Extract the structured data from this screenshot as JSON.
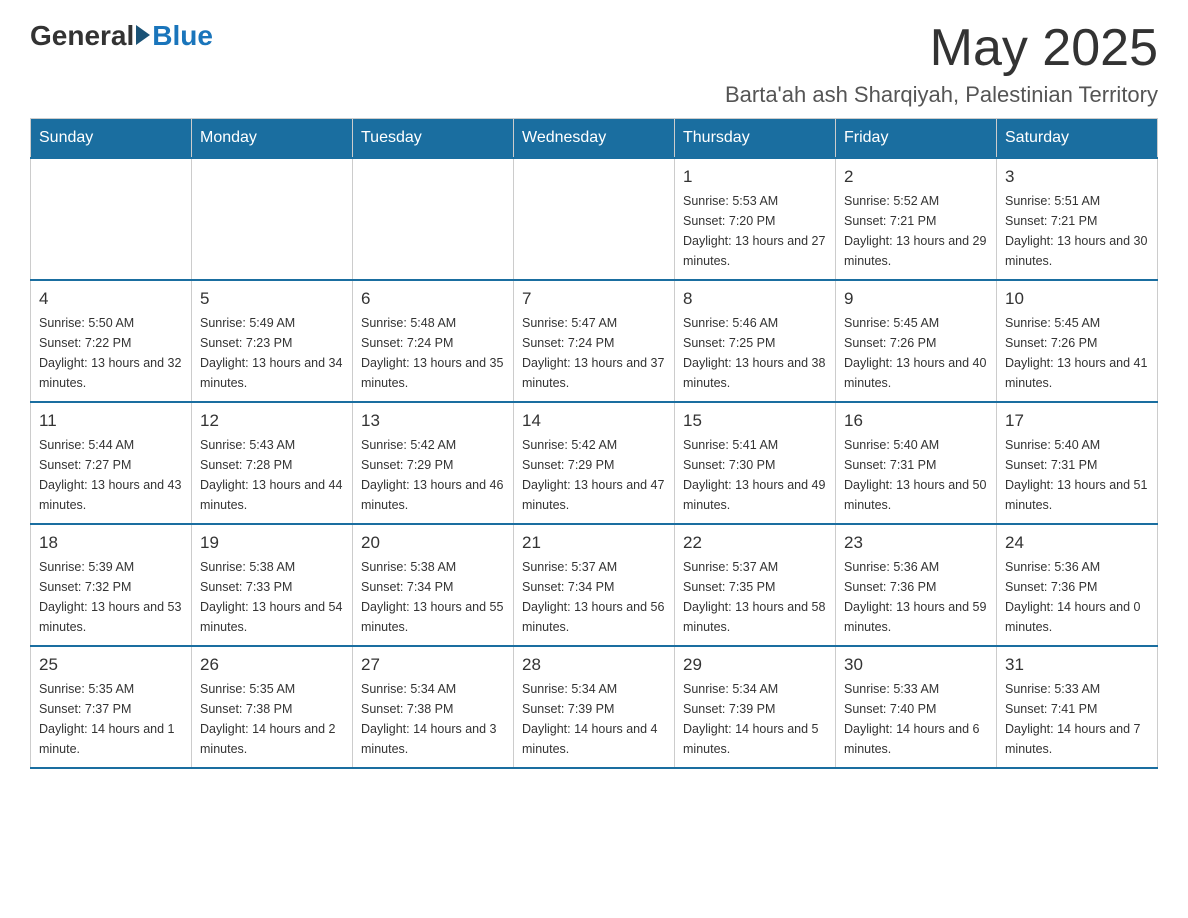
{
  "logo": {
    "general": "General",
    "blue": "Blue"
  },
  "title": {
    "month_year": "May 2025",
    "location": "Barta'ah ash Sharqiyah, Palestinian Territory"
  },
  "days_of_week": [
    "Sunday",
    "Monday",
    "Tuesday",
    "Wednesday",
    "Thursday",
    "Friday",
    "Saturday"
  ],
  "weeks": [
    [
      {
        "day": "",
        "info": ""
      },
      {
        "day": "",
        "info": ""
      },
      {
        "day": "",
        "info": ""
      },
      {
        "day": "",
        "info": ""
      },
      {
        "day": "1",
        "info": "Sunrise: 5:53 AM\nSunset: 7:20 PM\nDaylight: 13 hours and 27 minutes."
      },
      {
        "day": "2",
        "info": "Sunrise: 5:52 AM\nSunset: 7:21 PM\nDaylight: 13 hours and 29 minutes."
      },
      {
        "day": "3",
        "info": "Sunrise: 5:51 AM\nSunset: 7:21 PM\nDaylight: 13 hours and 30 minutes."
      }
    ],
    [
      {
        "day": "4",
        "info": "Sunrise: 5:50 AM\nSunset: 7:22 PM\nDaylight: 13 hours and 32 minutes."
      },
      {
        "day": "5",
        "info": "Sunrise: 5:49 AM\nSunset: 7:23 PM\nDaylight: 13 hours and 34 minutes."
      },
      {
        "day": "6",
        "info": "Sunrise: 5:48 AM\nSunset: 7:24 PM\nDaylight: 13 hours and 35 minutes."
      },
      {
        "day": "7",
        "info": "Sunrise: 5:47 AM\nSunset: 7:24 PM\nDaylight: 13 hours and 37 minutes."
      },
      {
        "day": "8",
        "info": "Sunrise: 5:46 AM\nSunset: 7:25 PM\nDaylight: 13 hours and 38 minutes."
      },
      {
        "day": "9",
        "info": "Sunrise: 5:45 AM\nSunset: 7:26 PM\nDaylight: 13 hours and 40 minutes."
      },
      {
        "day": "10",
        "info": "Sunrise: 5:45 AM\nSunset: 7:26 PM\nDaylight: 13 hours and 41 minutes."
      }
    ],
    [
      {
        "day": "11",
        "info": "Sunrise: 5:44 AM\nSunset: 7:27 PM\nDaylight: 13 hours and 43 minutes."
      },
      {
        "day": "12",
        "info": "Sunrise: 5:43 AM\nSunset: 7:28 PM\nDaylight: 13 hours and 44 minutes."
      },
      {
        "day": "13",
        "info": "Sunrise: 5:42 AM\nSunset: 7:29 PM\nDaylight: 13 hours and 46 minutes."
      },
      {
        "day": "14",
        "info": "Sunrise: 5:42 AM\nSunset: 7:29 PM\nDaylight: 13 hours and 47 minutes."
      },
      {
        "day": "15",
        "info": "Sunrise: 5:41 AM\nSunset: 7:30 PM\nDaylight: 13 hours and 49 minutes."
      },
      {
        "day": "16",
        "info": "Sunrise: 5:40 AM\nSunset: 7:31 PM\nDaylight: 13 hours and 50 minutes."
      },
      {
        "day": "17",
        "info": "Sunrise: 5:40 AM\nSunset: 7:31 PM\nDaylight: 13 hours and 51 minutes."
      }
    ],
    [
      {
        "day": "18",
        "info": "Sunrise: 5:39 AM\nSunset: 7:32 PM\nDaylight: 13 hours and 53 minutes."
      },
      {
        "day": "19",
        "info": "Sunrise: 5:38 AM\nSunset: 7:33 PM\nDaylight: 13 hours and 54 minutes."
      },
      {
        "day": "20",
        "info": "Sunrise: 5:38 AM\nSunset: 7:34 PM\nDaylight: 13 hours and 55 minutes."
      },
      {
        "day": "21",
        "info": "Sunrise: 5:37 AM\nSunset: 7:34 PM\nDaylight: 13 hours and 56 minutes."
      },
      {
        "day": "22",
        "info": "Sunrise: 5:37 AM\nSunset: 7:35 PM\nDaylight: 13 hours and 58 minutes."
      },
      {
        "day": "23",
        "info": "Sunrise: 5:36 AM\nSunset: 7:36 PM\nDaylight: 13 hours and 59 minutes."
      },
      {
        "day": "24",
        "info": "Sunrise: 5:36 AM\nSunset: 7:36 PM\nDaylight: 14 hours and 0 minutes."
      }
    ],
    [
      {
        "day": "25",
        "info": "Sunrise: 5:35 AM\nSunset: 7:37 PM\nDaylight: 14 hours and 1 minute."
      },
      {
        "day": "26",
        "info": "Sunrise: 5:35 AM\nSunset: 7:38 PM\nDaylight: 14 hours and 2 minutes."
      },
      {
        "day": "27",
        "info": "Sunrise: 5:34 AM\nSunset: 7:38 PM\nDaylight: 14 hours and 3 minutes."
      },
      {
        "day": "28",
        "info": "Sunrise: 5:34 AM\nSunset: 7:39 PM\nDaylight: 14 hours and 4 minutes."
      },
      {
        "day": "29",
        "info": "Sunrise: 5:34 AM\nSunset: 7:39 PM\nDaylight: 14 hours and 5 minutes."
      },
      {
        "day": "30",
        "info": "Sunrise: 5:33 AM\nSunset: 7:40 PM\nDaylight: 14 hours and 6 minutes."
      },
      {
        "day": "31",
        "info": "Sunrise: 5:33 AM\nSunset: 7:41 PM\nDaylight: 14 hours and 7 minutes."
      }
    ]
  ]
}
